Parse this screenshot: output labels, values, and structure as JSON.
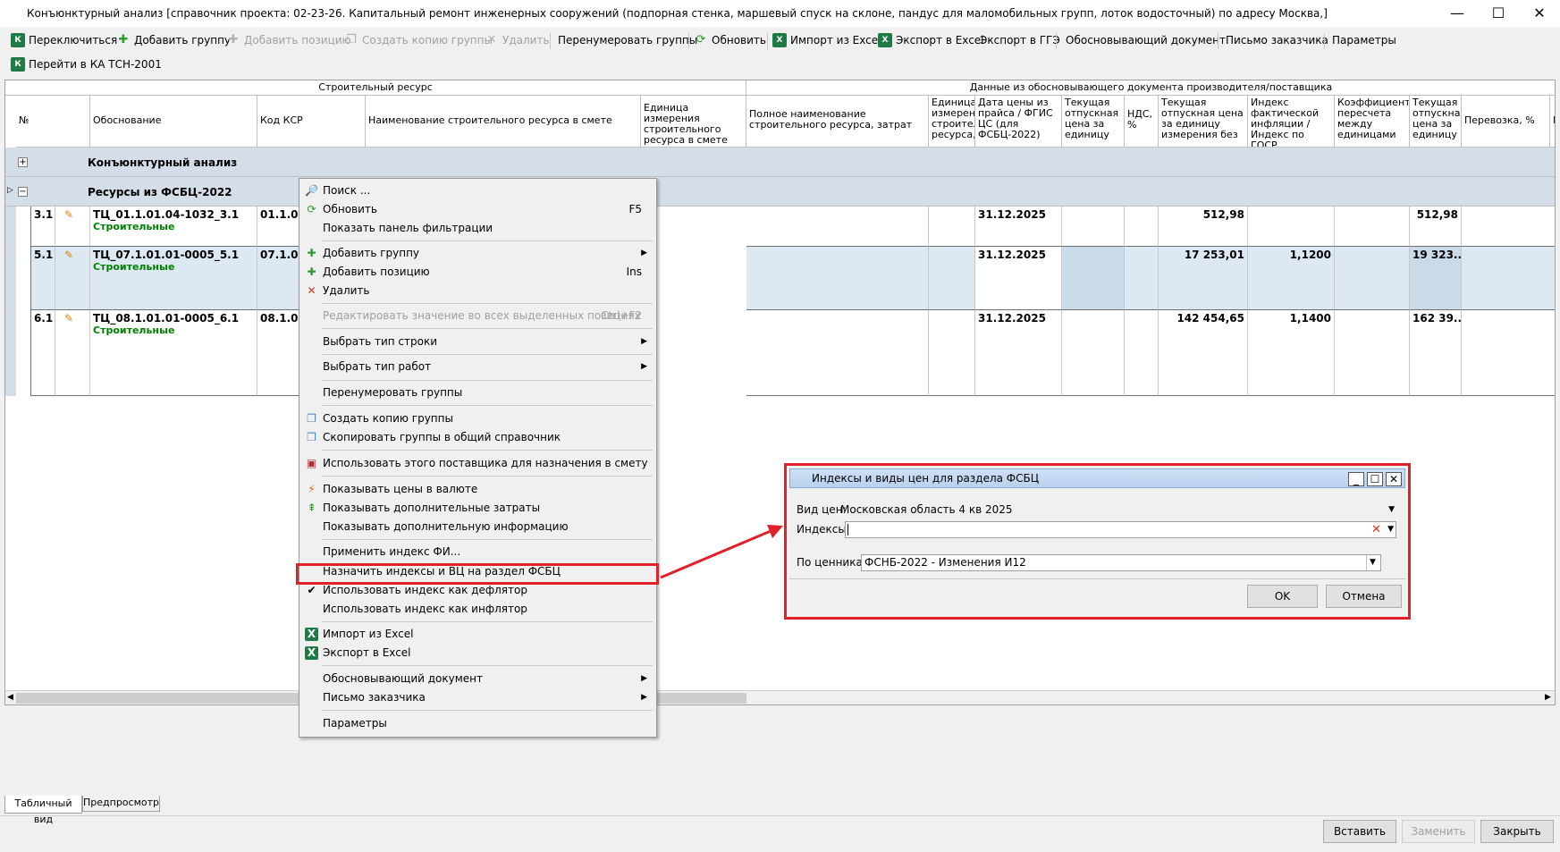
{
  "window": {
    "title": "Конъюнктурный анализ [справочник проекта: 02-23-26. Капитальный ремонт инженерных сооружений (подпорная стенка, маршевый спуск на склоне, пандус для маломобильных групп, лоток водосточный) по адресу Москва,]",
    "minimize": "—",
    "maximize": "☐",
    "close": "✕"
  },
  "toolbar1": {
    "switch": "Переключиться",
    "add_group": "Добавить группу",
    "add_position": "Добавить позицию",
    "copy_group": "Создать копию группы",
    "delete": "Удалить",
    "renumber": "Перенумеровать группы",
    "refresh": "Обновить",
    "import_excel": "Импорт из Excel",
    "export_excel": "Экспорт в Excel",
    "export_gge": "Экспорт в ГГЭ",
    "basis_doc": "Обосновывающий документ",
    "customer_letter": "Письмо заказчика",
    "params": "Параметры"
  },
  "toolbar2": {
    "goto_ka": "Перейти в КА ТСН-2001"
  },
  "grid": {
    "band1": "Строительный ресурс",
    "band2": "Данные из обосновывающего документа производителя/поставщика",
    "columns": [
      "№",
      "Обоснование",
      "Код КСР",
      "Наименование строительного ресурса в смете",
      "Единица измерения строительного ресурса в смете",
      "Полное наименование строительного ресурса, затрат",
      "Единица измерения строительного ресурса,",
      "Дата цены из прайса / ФГИС ЦС (для ФСБЦ-2022)",
      "Текущая отпускная цена за единицу",
      "НДС, %",
      "Текущая отпускная цена за единицу измерения без",
      "Индекс фактической инфляции / Индекс по ГОСР",
      "Коэффициент пересчета между единицами",
      "Текущая отпускная цена за единицу",
      "Перевозка, %",
      "П"
    ],
    "group1": "Конъюнктурный анализ",
    "group2": "Ресурсы из ФСБЦ-2022",
    "rows": [
      {
        "num": "3.1",
        "code": "ТЦ_01.1.01.04-1032_3.1",
        "type": "Строительные",
        "ksr": "01.1.01.0",
        "date": "31.12.2025",
        "price": "512,98",
        "index": "",
        "cur": "512,98"
      },
      {
        "num": "5.1",
        "code": "ТЦ_07.1.01.01-0005_5.1",
        "type": "Строительные",
        "ksr": "07.1.01.0",
        "date": "31.12.2025",
        "price": "17 253,01",
        "index": "1,1200",
        "cur": "19 323..."
      },
      {
        "num": "6.1",
        "code": "ТЦ_08.1.01.01-0005_6.1",
        "type": "Строительные",
        "ksr": "08.1.01.0",
        "date": "31.12.2025",
        "price": "142 454,65",
        "index": "1,1400",
        "cur": "162 39..."
      }
    ]
  },
  "menu": {
    "search": "Поиск ...",
    "refresh": "Обновить",
    "refresh_sc": "F5",
    "filter_panel": "Показать панель фильтрации",
    "add_group": "Добавить группу",
    "add_position": "Добавить позицию",
    "add_position_sc": "Ins",
    "delete": "Удалить",
    "edit_all": "Редактировать значение во всех выделенных позициях",
    "edit_all_sc": "Ctrl+F2",
    "row_type": "Выбрать тип строки",
    "work_type": "Выбрать тип работ",
    "renumber": "Перенумеровать группы",
    "copy_group": "Создать копию группы",
    "copy_to_common": "Скопировать группы в общий справочник",
    "use_supplier": "Использовать этого поставщика для назначения в смету",
    "show_currency": "Показывать цены в валюте",
    "show_extra_costs": "Показывать дополнительные затраты",
    "show_extra_info": "Показывать дополнительную информацию",
    "apply_index": "Применить индекс ФИ...",
    "assign_index": "Назначить индексы и ВЦ на раздел ФСБЦ",
    "use_deflator": "Использовать индекс как дефлятор",
    "use_inflator": "Использовать индекс как инфлятор",
    "import_excel": "Импорт из Excel",
    "export_excel": "Экспорт в Excel",
    "basis_doc": "Обосновывающий документ",
    "customer_letter": "Письмо заказчика",
    "params": "Параметры"
  },
  "dialog": {
    "title": "Индексы и виды цен для раздела ФСБЦ",
    "price_type_label": "Вид цен:",
    "price_type_value": "Московская область 4 кв 2025",
    "indexes_label": "Индексы:",
    "indexes_value": "",
    "pricebook_label": "По ценникам",
    "pricebook_value": "ФСНБ-2022 - Изменения И12",
    "ok": "OK",
    "cancel": "Отмена"
  },
  "tabs": {
    "table_view": "Табличный вид",
    "preview": "Предпросмотр"
  },
  "bottom": {
    "insert": "Вставить",
    "replace": "Заменить",
    "close": "Закрыть"
  },
  "colors": {
    "highlight": "#e0202a",
    "group_bg": "#d4dde8",
    "selected_row": "#dce9f2"
  }
}
